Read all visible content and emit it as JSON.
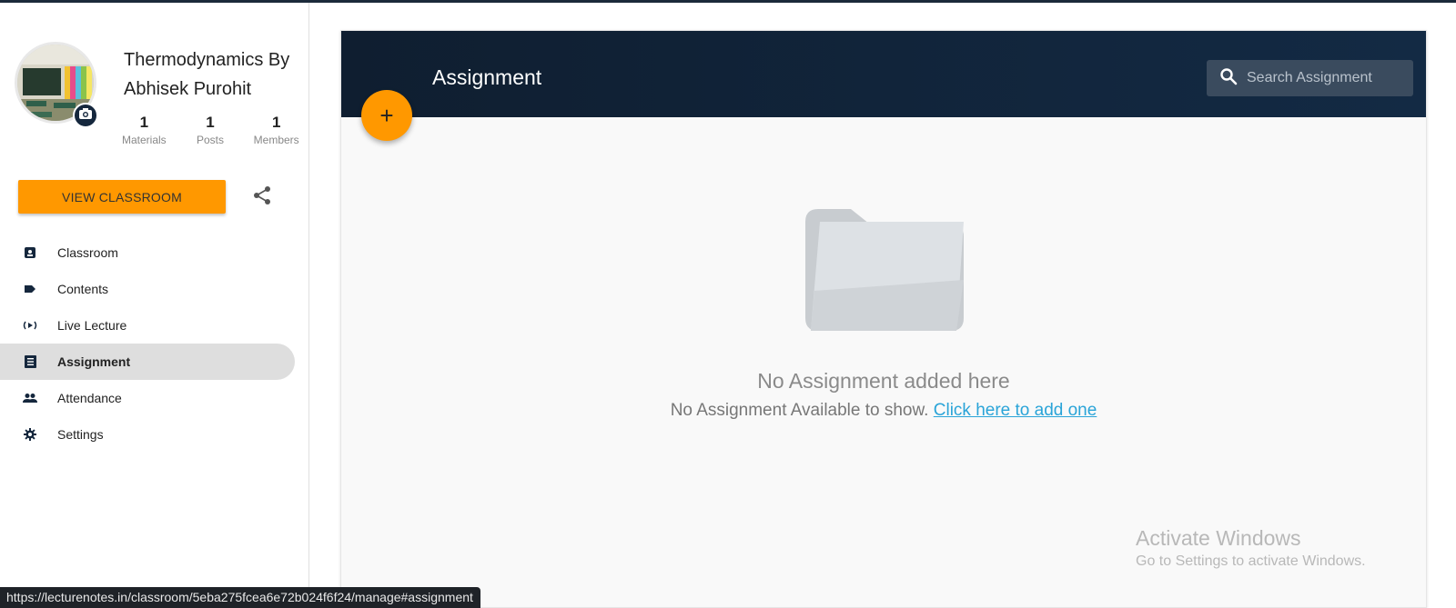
{
  "sidebar": {
    "class_title": "Thermodynamics By Abhisek Purohit",
    "stats": [
      {
        "value": "1",
        "label": "Materials"
      },
      {
        "value": "1",
        "label": "Posts"
      },
      {
        "value": "1",
        "label": "Members"
      }
    ],
    "view_button": "VIEW CLASSROOM",
    "nav_items": [
      {
        "label": "Classroom",
        "icon": "classroom-icon"
      },
      {
        "label": "Contents",
        "icon": "label-icon"
      },
      {
        "label": "Live Lecture",
        "icon": "live-icon"
      },
      {
        "label": "Assignment",
        "icon": "list-icon",
        "active": true
      },
      {
        "label": "Attendance",
        "icon": "people-icon"
      },
      {
        "label": "Settings",
        "icon": "gear-icon"
      }
    ]
  },
  "main": {
    "title": "Assignment",
    "search_placeholder": "Search Assignment",
    "add_button": "+",
    "empty_title": "No Assignment added here",
    "empty_text": "No Assignment Available to show.",
    "empty_link": "Click here to add one"
  },
  "status_bar": {
    "url": "https://lecturenotes.in/classroom/5eba275fcea6e72b024f6f24/manage#assignment"
  },
  "watermark": {
    "title": "Activate Windows",
    "subtitle": "Go to Settings to activate Windows."
  },
  "colors": {
    "accent": "#ff9800",
    "header": "#0f1e30",
    "link": "#2aa4d8"
  }
}
